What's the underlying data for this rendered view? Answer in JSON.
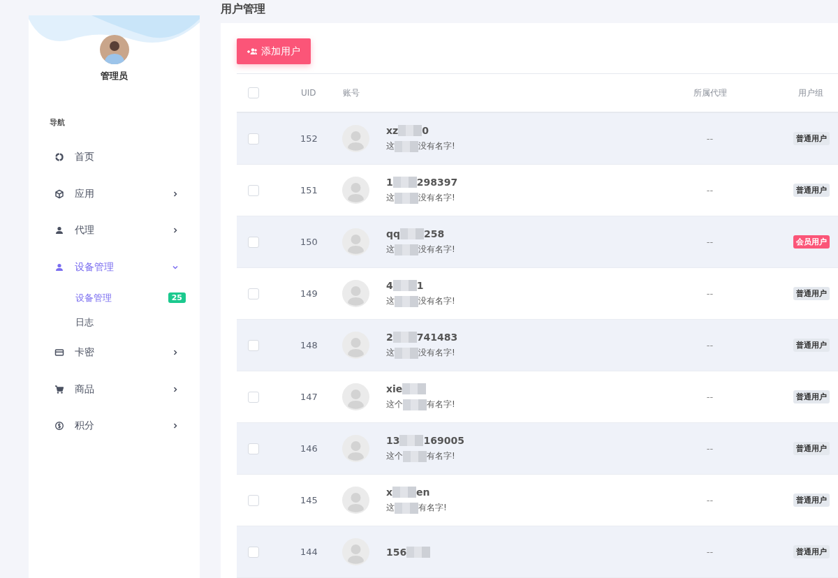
{
  "sidebar": {
    "user": {
      "name": "管理员"
    },
    "nav_heading": "导航",
    "items": [
      {
        "label": "首页",
        "kind": "link",
        "selected": false
      },
      {
        "label": "应用",
        "kind": "group",
        "expanded": false,
        "selected": false
      },
      {
        "label": "代理",
        "kind": "group",
        "expanded": false,
        "selected": false
      },
      {
        "label": "设备管理",
        "kind": "group",
        "expanded": true,
        "selected": true,
        "children": [
          {
            "label": "设备管理",
            "selected": true,
            "badge": "25"
          },
          {
            "label": "日志",
            "selected": false
          }
        ]
      },
      {
        "label": "卡密",
        "kind": "group",
        "expanded": false,
        "selected": false
      },
      {
        "label": "商品",
        "kind": "group",
        "expanded": false,
        "selected": false
      },
      {
        "label": "积分",
        "kind": "group",
        "expanded": false,
        "selected": false
      }
    ]
  },
  "page_title": "用户管理",
  "add_button": "添加用户",
  "table": {
    "columns": [
      "UID",
      "账号",
      "所属代理",
      "用户组"
    ],
    "header_checked": false,
    "rows": [
      {
        "checked": false,
        "uid": "152",
        "account_parts": [
          "xz",
          "0"
        ],
        "note_parts": [
          "这",
          "没有名字!"
        ],
        "agent": "--",
        "group": {
          "label": "普通用户",
          "kind": "normal"
        }
      },
      {
        "checked": false,
        "uid": "151",
        "account_parts": [
          "1",
          "298397"
        ],
        "note_parts": [
          "这",
          "没有名字!"
        ],
        "agent": "--",
        "group": {
          "label": "普通用户",
          "kind": "normal"
        }
      },
      {
        "checked": false,
        "uid": "150",
        "account_parts": [
          "qq",
          "258"
        ],
        "note_parts": [
          "这",
          "没有名字!"
        ],
        "agent": "--",
        "group": {
          "label": "会员用户",
          "kind": "member"
        }
      },
      {
        "checked": false,
        "uid": "149",
        "account_parts": [
          "4",
          "1"
        ],
        "note_parts": [
          "这",
          "没有名字!"
        ],
        "agent": "--",
        "group": {
          "label": "普通用户",
          "kind": "normal"
        }
      },
      {
        "checked": false,
        "uid": "148",
        "account_parts": [
          "2",
          "741483"
        ],
        "note_parts": [
          "这",
          "没有名字!"
        ],
        "agent": "--",
        "group": {
          "label": "普通用户",
          "kind": "normal"
        }
      },
      {
        "checked": false,
        "uid": "147",
        "account_parts": [
          "xie"
        ],
        "note_parts": [
          "这个",
          "有名字!"
        ],
        "agent": "--",
        "group": {
          "label": "普通用户",
          "kind": "normal"
        }
      },
      {
        "checked": false,
        "uid": "146",
        "account_parts": [
          "13",
          "169005"
        ],
        "note_parts": [
          "这个",
          "有名字!"
        ],
        "agent": "--",
        "group": {
          "label": "普通用户",
          "kind": "normal"
        }
      },
      {
        "checked": false,
        "uid": "145",
        "account_parts": [
          "x",
          "en"
        ],
        "note_parts": [
          "这",
          "有名字!"
        ],
        "agent": "--",
        "group": {
          "label": "普通用户",
          "kind": "normal"
        }
      },
      {
        "checked": false,
        "uid": "144",
        "account_parts": [
          "156"
        ],
        "agent": "--",
        "group": {
          "label": "普通用户",
          "kind": "normal"
        }
      }
    ]
  }
}
